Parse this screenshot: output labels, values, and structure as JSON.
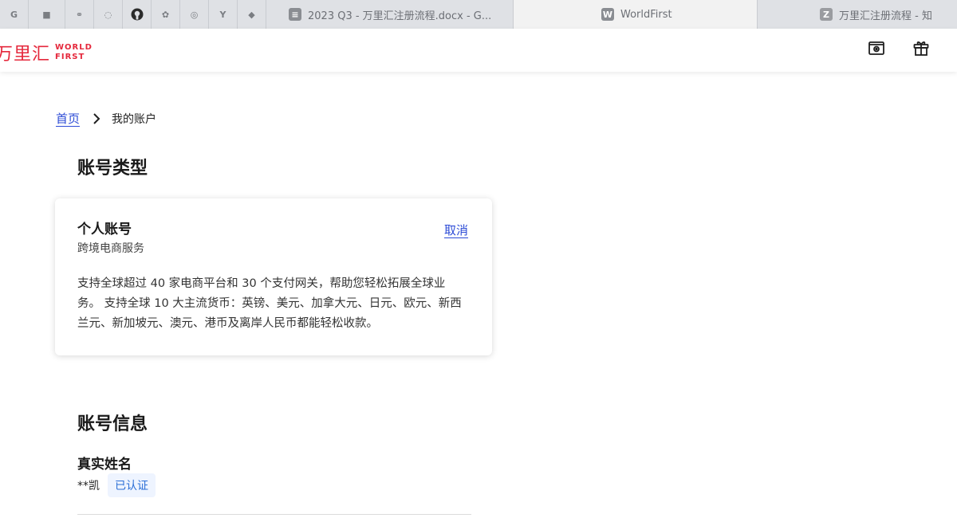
{
  "browser": {
    "pinned_tabs": [
      {
        "icon": "google-icon",
        "glyph": "G"
      },
      {
        "icon": "notion-icon",
        "glyph": "■"
      },
      {
        "icon": "link-icon",
        "glyph": "⚭"
      },
      {
        "icon": "loading-icon",
        "glyph": "◌"
      },
      {
        "icon": "github-icon",
        "glyph": "●"
      },
      {
        "icon": "baidu-icon",
        "glyph": "✿"
      },
      {
        "icon": "openai-icon",
        "glyph": "◎"
      },
      {
        "icon": "y-icon",
        "glyph": "Y"
      },
      {
        "icon": "diamond-icon",
        "glyph": "◆"
      }
    ],
    "tabs": [
      {
        "favicon": "docs-icon",
        "title": "2023 Q3 - 万里汇注册流程.docx - G..."
      },
      {
        "favicon": "worldfirst-icon",
        "favicon_letter": "W",
        "title": "WorldFirst"
      },
      {
        "favicon": "zhihu-icon",
        "favicon_letter": "Z",
        "title": "万里汇注册流程 - 知"
      }
    ]
  },
  "header": {
    "logo_cn": "万里汇",
    "logo_en_line1": "WORLD",
    "logo_en_line2": "FIRST",
    "icons": [
      "wallet-icon",
      "gift-icon"
    ]
  },
  "breadcrumb": {
    "home": "首页",
    "current": "我的账户"
  },
  "account_type": {
    "section_title": "账号类型",
    "card_title": "个人账号",
    "card_subtitle": "跨境电商服务",
    "cancel_label": "取消",
    "description": "支持全球超过 40 家电商平台和 30 个支付网关，帮助您轻松拓展全球业务。 支持全球 10 大主流货币：英镑、美元、加拿大元、日元、欧元、新西兰元、新加坡元、澳元、港币及离岸人民币都能轻松收款。"
  },
  "account_info": {
    "section_title": "账号信息",
    "real_name_label": "真实姓名",
    "real_name_value": "**凯",
    "verified_badge": "已认证"
  },
  "colors": {
    "brand_red": "#e5283c",
    "link_blue": "#2c4bd6",
    "badge_bg": "#eef4ff",
    "badge_text": "#2c6fd6"
  }
}
